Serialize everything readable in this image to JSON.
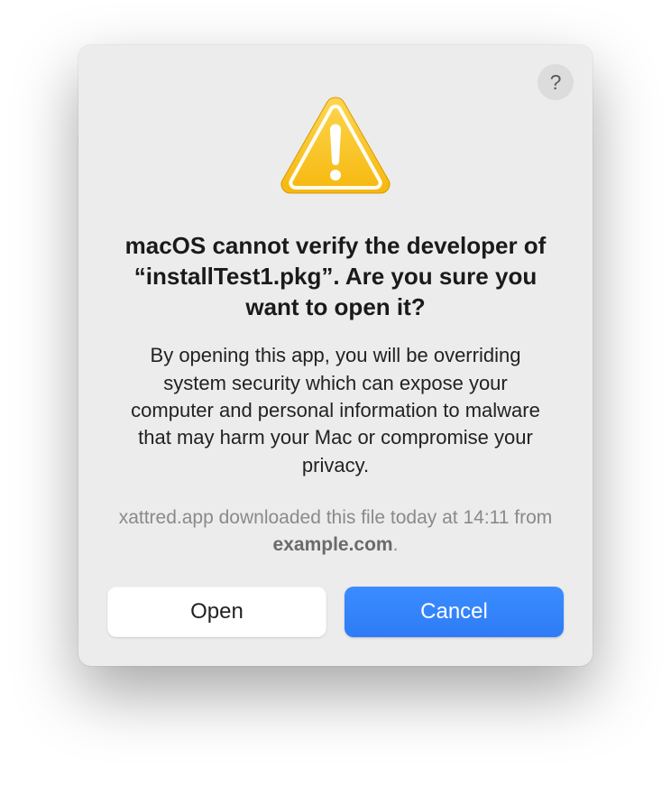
{
  "dialog": {
    "title": "macOS cannot verify the developer of “installTest1.pkg”. Are you sure you want to open it?",
    "body": "By opening this app, you will be overriding system security which can expose your computer and personal information to malware that may harm your Mac or compromise your privacy.",
    "quarantine": {
      "prefix": "xattred.app downloaded this file today at 14:11 from ",
      "domain": "example.com",
      "suffix": "."
    },
    "buttons": {
      "open": "Open",
      "cancel": "Cancel"
    },
    "help_label": "?"
  }
}
